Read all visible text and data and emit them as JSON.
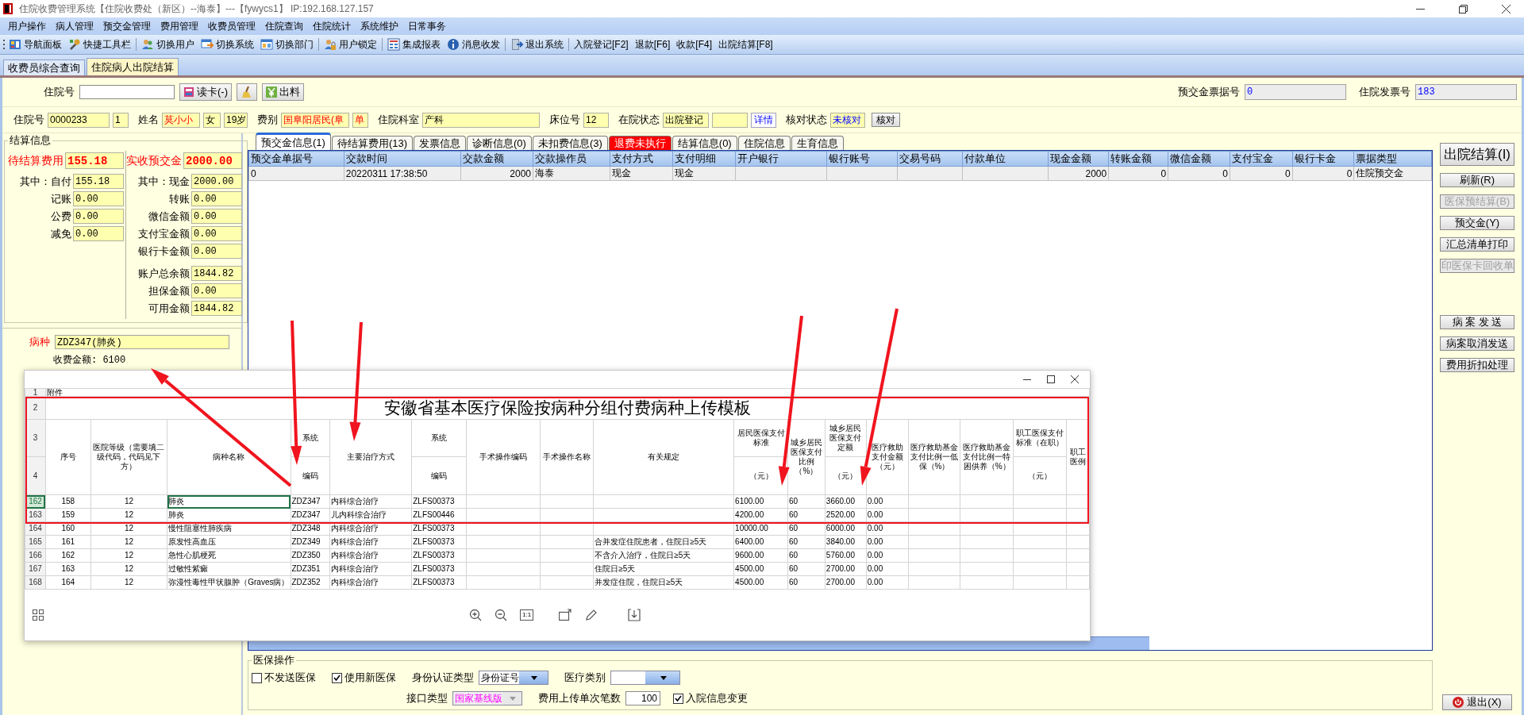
{
  "window": {
    "title": "住院收费管理系统【住院收费处（新区）--海泰】---【fywycs1】 IP:192.168.127.157"
  },
  "menu": [
    "用户操作",
    "病人管理",
    "预交金管理",
    "费用管理",
    "收费员管理",
    "住院查询",
    "住院统计",
    "系统维护",
    "日常事务"
  ],
  "toolbar": [
    {
      "label": "导航面板",
      "kind": "icon"
    },
    {
      "label": "快捷工具栏",
      "kind": "icon"
    },
    {
      "label": "切换用户",
      "kind": "icon"
    },
    {
      "label": "切换系统",
      "kind": "icon"
    },
    {
      "label": "切换部门",
      "kind": "icon"
    },
    {
      "label": "用户锁定",
      "kind": "icon"
    },
    {
      "label": "集成报表",
      "kind": "icon"
    },
    {
      "label": "消息收发",
      "kind": "icon"
    },
    {
      "label": "退出系统",
      "kind": "icon"
    },
    {
      "label": "入院登记[F2]",
      "kind": "text"
    },
    {
      "label": "退款[F6]",
      "kind": "text"
    },
    {
      "label": "收款[F4]",
      "kind": "text"
    },
    {
      "label": "出院结算[F8]",
      "kind": "text"
    }
  ],
  "doc_tabs": [
    {
      "label": "收费员综合查询",
      "selected": false
    },
    {
      "label": "住院病人出院结算",
      "selected": true
    }
  ],
  "lookup": {
    "label": "住院号",
    "read_button": "读卡(-)",
    "material_button": "出料"
  },
  "receipt_no": {
    "label": "预交金票据号",
    "value": "0"
  },
  "invoice_no": {
    "label": "住院发票号",
    "value": "183"
  },
  "patient": [
    {
      "kind": "label",
      "text": "住院号"
    },
    {
      "kind": "field",
      "text": "0000233"
    },
    {
      "kind": "field",
      "text": "1"
    },
    {
      "kind": "label",
      "text": "姓名"
    },
    {
      "kind": "field",
      "text": "莫小小",
      "warning": true
    },
    {
      "kind": "field",
      "text": "女"
    },
    {
      "kind": "field",
      "text": "19岁"
    },
    {
      "kind": "label",
      "text": "费别"
    },
    {
      "kind": "field",
      "text": "国阜阳居民(阜",
      "warning": true
    },
    {
      "kind": "field",
      "text": "单",
      "warning": true
    },
    {
      "kind": "label",
      "text": "住院科室"
    },
    {
      "kind": "field",
      "text": "产科"
    },
    {
      "kind": "label",
      "text": "床位号"
    },
    {
      "kind": "field",
      "text": "12"
    },
    {
      "kind": "label",
      "text": "在院状态"
    },
    {
      "kind": "field",
      "text": "出院登记"
    },
    {
      "kind": "field"
    },
    {
      "kind": "link",
      "text": "详情"
    },
    {
      "kind": "label",
      "text": "核对状态"
    },
    {
      "kind": "field",
      "text": "未核对",
      "info": true
    },
    {
      "kind": "button",
      "text": "核对"
    }
  ],
  "settlement": {
    "title": "结算信息",
    "left": [
      {
        "label": "待结算费用",
        "value": "155.18",
        "kind": "total"
      },
      {
        "label": "其中：自付",
        "value": "155.18",
        "kind": "item"
      },
      {
        "label": "记账",
        "value": "0.00",
        "kind": "item"
      },
      {
        "label": "公费",
        "value": "0.00",
        "kind": "item"
      },
      {
        "label": "减免",
        "value": "0.00",
        "kind": "item"
      }
    ],
    "right": [
      {
        "label": "实收预交金",
        "value": "2000.00",
        "kind": "total"
      },
      {
        "label": "其中：现金",
        "value": "2000.00",
        "kind": "item"
      },
      {
        "label": "转账",
        "value": "0.00",
        "kind": "item"
      },
      {
        "label": "微信金额",
        "value": "0.00",
        "kind": "item"
      },
      {
        "label": "支付宝金额",
        "value": "0.00",
        "kind": "item"
      },
      {
        "label": "银行卡金额",
        "value": "0.00",
        "kind": "item"
      },
      {
        "label": "账户总余额",
        "value": "1844.82",
        "kind": "item"
      },
      {
        "label": "担保金额",
        "value": "0.00",
        "kind": "item"
      },
      {
        "label": "可用金额",
        "value": "1844.82",
        "kind": "item"
      }
    ]
  },
  "diagnosis": {
    "label": "病种",
    "value": "ZDZ347(肺炎)",
    "fee": "收费金额: 6100"
  },
  "main_tabs": [
    {
      "label": "预交金信息(1)",
      "selected": true,
      "alert": false
    },
    {
      "label": "待结算费用(13)",
      "selected": false,
      "alert": false
    },
    {
      "label": "发票信息",
      "selected": false,
      "alert": false
    },
    {
      "label": "诊断信息(0)",
      "selected": false,
      "alert": false
    },
    {
      "label": "未扣费信息(3)",
      "selected": false,
      "alert": false
    },
    {
      "label": "退费未执行",
      "selected": false,
      "alert": true
    },
    {
      "label": "结算信息(0)",
      "selected": false,
      "alert": false
    },
    {
      "label": "住院信息",
      "selected": false,
      "alert": false
    },
    {
      "label": "生育信息",
      "selected": false,
      "alert": false
    }
  ],
  "grid": {
    "columns": [
      {
        "label": "预交金单据号",
        "numeric": false
      },
      {
        "label": "交款时间",
        "numeric": false
      },
      {
        "label": "交款金额",
        "numeric": true
      },
      {
        "label": "交款操作员",
        "numeric": false
      },
      {
        "label": "支付方式",
        "numeric": false
      },
      {
        "label": "支付明细",
        "numeric": false
      },
      {
        "label": "开户银行"
      },
      {
        "label": "银行账号"
      },
      {
        "label": "交易号码"
      },
      {
        "label": "付款单位"
      },
      {
        "label": "现金金额",
        "numeric": true
      },
      {
        "label": "转账金额",
        "numeric": true
      },
      {
        "label": "微信金额",
        "numeric": true
      },
      {
        "label": "支付宝金",
        "numeric": true
      },
      {
        "label": "银行卡金",
        "numeric": true
      },
      {
        "label": "票据类型",
        "numeric": false
      }
    ],
    "rows": [
      [
        "0",
        "20220311 17:38:50",
        "2000",
        "海泰",
        "现金",
        "现金",
        null,
        null,
        null,
        null,
        "2000",
        "0",
        "0",
        "0",
        "0",
        "住院预交金"
      ]
    ]
  },
  "side_buttons": [
    {
      "label": "刷新(R)",
      "disabled": false
    },
    {
      "label": "医保预结算(B)",
      "disabled": true
    },
    {
      "label": "预交金(Y)",
      "disabled": false
    },
    {
      "label": "汇总清单打印",
      "disabled": false
    },
    {
      "label": "印医保卡回收单",
      "disabled": true
    }
  ],
  "settle_button": "出院结算(I)",
  "record_buttons": [
    {
      "label": "病 案 发 送",
      "disabled": false
    },
    {
      "label": "病案取消发送",
      "disabled": false
    },
    {
      "label": "费用折扣处理",
      "disabled": false
    }
  ],
  "exit_button": "退出(X)",
  "insurance": {
    "title": "医保操作",
    "items": [
      {
        "kind": "checkbox",
        "label": "不发送医保",
        "checked": false
      },
      {
        "kind": "checkbox",
        "label": "使用新医保",
        "checked": true
      },
      {
        "kind": "select",
        "label": "身份认证类型",
        "value": "身份证号",
        "disabled": false
      },
      {
        "kind": "select",
        "label": "医疗类别",
        "disabled": false
      },
      {
        "kind": "select",
        "label": "接口类型",
        "value": "国家基线版",
        "disabled": true,
        "accent": true,
        "break_before": true
      },
      {
        "kind": "number",
        "label": "费用上传单次笔数",
        "value": "100"
      },
      {
        "kind": "checkbox",
        "label": "入院信息变更",
        "checked": true
      }
    ]
  },
  "image_viewer": {
    "actual_size": "1:1",
    "sheet": {
      "header_row_numbers": [
        "1",
        "2",
        "3",
        "4"
      ],
      "note": "附件",
      "title": "安徽省基本医疗保险按病种分组付费病种上传模板",
      "headers": [
        {
          "text": "序号"
        },
        {
          "text": "医院等级（需要填二级代码，代码见下方）"
        },
        {
          "text": "病种名称"
        },
        {
          "top": "系统",
          "bottom": "编码"
        },
        {
          "text": "主要治疗方式"
        },
        {
          "top": "系统",
          "bottom": "编码"
        },
        {
          "text": "手术操作编码"
        },
        {
          "text": "手术操作名称"
        },
        {
          "text": "有关规定"
        },
        {
          "top": "居民医保支付标准",
          "bottom": "（元）"
        },
        {
          "text": "城乡居民医保支付比例（%）"
        },
        {
          "top": "城乡居民医保支付定额",
          "bottom": "（元）"
        },
        {
          "text": "医疗救助支付金额（元）"
        },
        {
          "text": "医疗救助基金支付比例一低保（%）"
        },
        {
          "text": "医疗救助基金支付比例一特困供养（%）"
        },
        {
          "top": "职工医保支付标准（在职）",
          "bottom": "（元）"
        },
        {
          "text": "职工医例"
        }
      ],
      "rows": [
        {
          "number": "162",
          "selected": true,
          "seq": "158",
          "grade": "12",
          "disease": "肺炎",
          "code": "ZDZ347",
          "treatment": "内科综合治疗",
          "system_code": "ZLFS00373",
          "standard": "6100.00",
          "ratio": "60",
          "quota": "3660.00",
          "aid": "0.00"
        },
        {
          "number": "163",
          "selected": false,
          "seq": "159",
          "grade": "12",
          "disease": "肺炎",
          "code": "ZDZ347",
          "treatment": "儿内科综合治疗",
          "system_code": "ZLFS00446",
          "standard": "4200.00",
          "ratio": "60",
          "quota": "2520.00",
          "aid": "0.00"
        },
        {
          "number": "164",
          "selected": false,
          "seq": "160",
          "grade": "12",
          "disease": "慢性阻塞性肺疾病",
          "code": "ZDZ348",
          "treatment": "内科综合治疗",
          "system_code": "ZLFS00373",
          "standard": "10000.00",
          "ratio": "60",
          "quota": "6000.00",
          "aid": "0.00"
        },
        {
          "number": "165",
          "selected": false,
          "seq": "161",
          "grade": "12",
          "disease": "原发性高血压",
          "code": "ZDZ349",
          "treatment": "内科综合治疗",
          "system_code": "ZLFS00373",
          "rule": "合并发症住院患者，住院日≥5天",
          "standard": "6400.00",
          "ratio": "60",
          "quota": "3840.00",
          "aid": "0.00"
        },
        {
          "number": "166",
          "selected": false,
          "seq": "162",
          "grade": "12",
          "disease": "急性心肌梗死",
          "code": "ZDZ350",
          "treatment": "内科综合治疗",
          "system_code": "ZLFS00373",
          "rule": "不含介入治疗，住院日≥5天",
          "standard": "9600.00",
          "ratio": "60",
          "quota": "5760.00",
          "aid": "0.00"
        },
        {
          "number": "167",
          "selected": false,
          "seq": "163",
          "grade": "12",
          "disease": "过敏性紫癜",
          "code": "ZDZ351",
          "treatment": "内科综合治疗",
          "system_code": "ZLFS00373",
          "rule": "住院日≥5天",
          "standard": "4500.00",
          "ratio": "60",
          "quota": "2700.00",
          "aid": "0.00"
        },
        {
          "number": "168",
          "selected": false,
          "seq": "164",
          "grade": "12",
          "disease": "弥漫性毒性甲状腺肿（Graves病）",
          "code": "ZDZ352",
          "treatment": "内科综合治疗",
          "system_code": "ZLFS00373",
          "rule": "并发症住院，住院日≥5天",
          "standard": "4500.00",
          "ratio": "60",
          "quota": "2700.00",
          "aid": "0.00"
        }
      ]
    }
  }
}
